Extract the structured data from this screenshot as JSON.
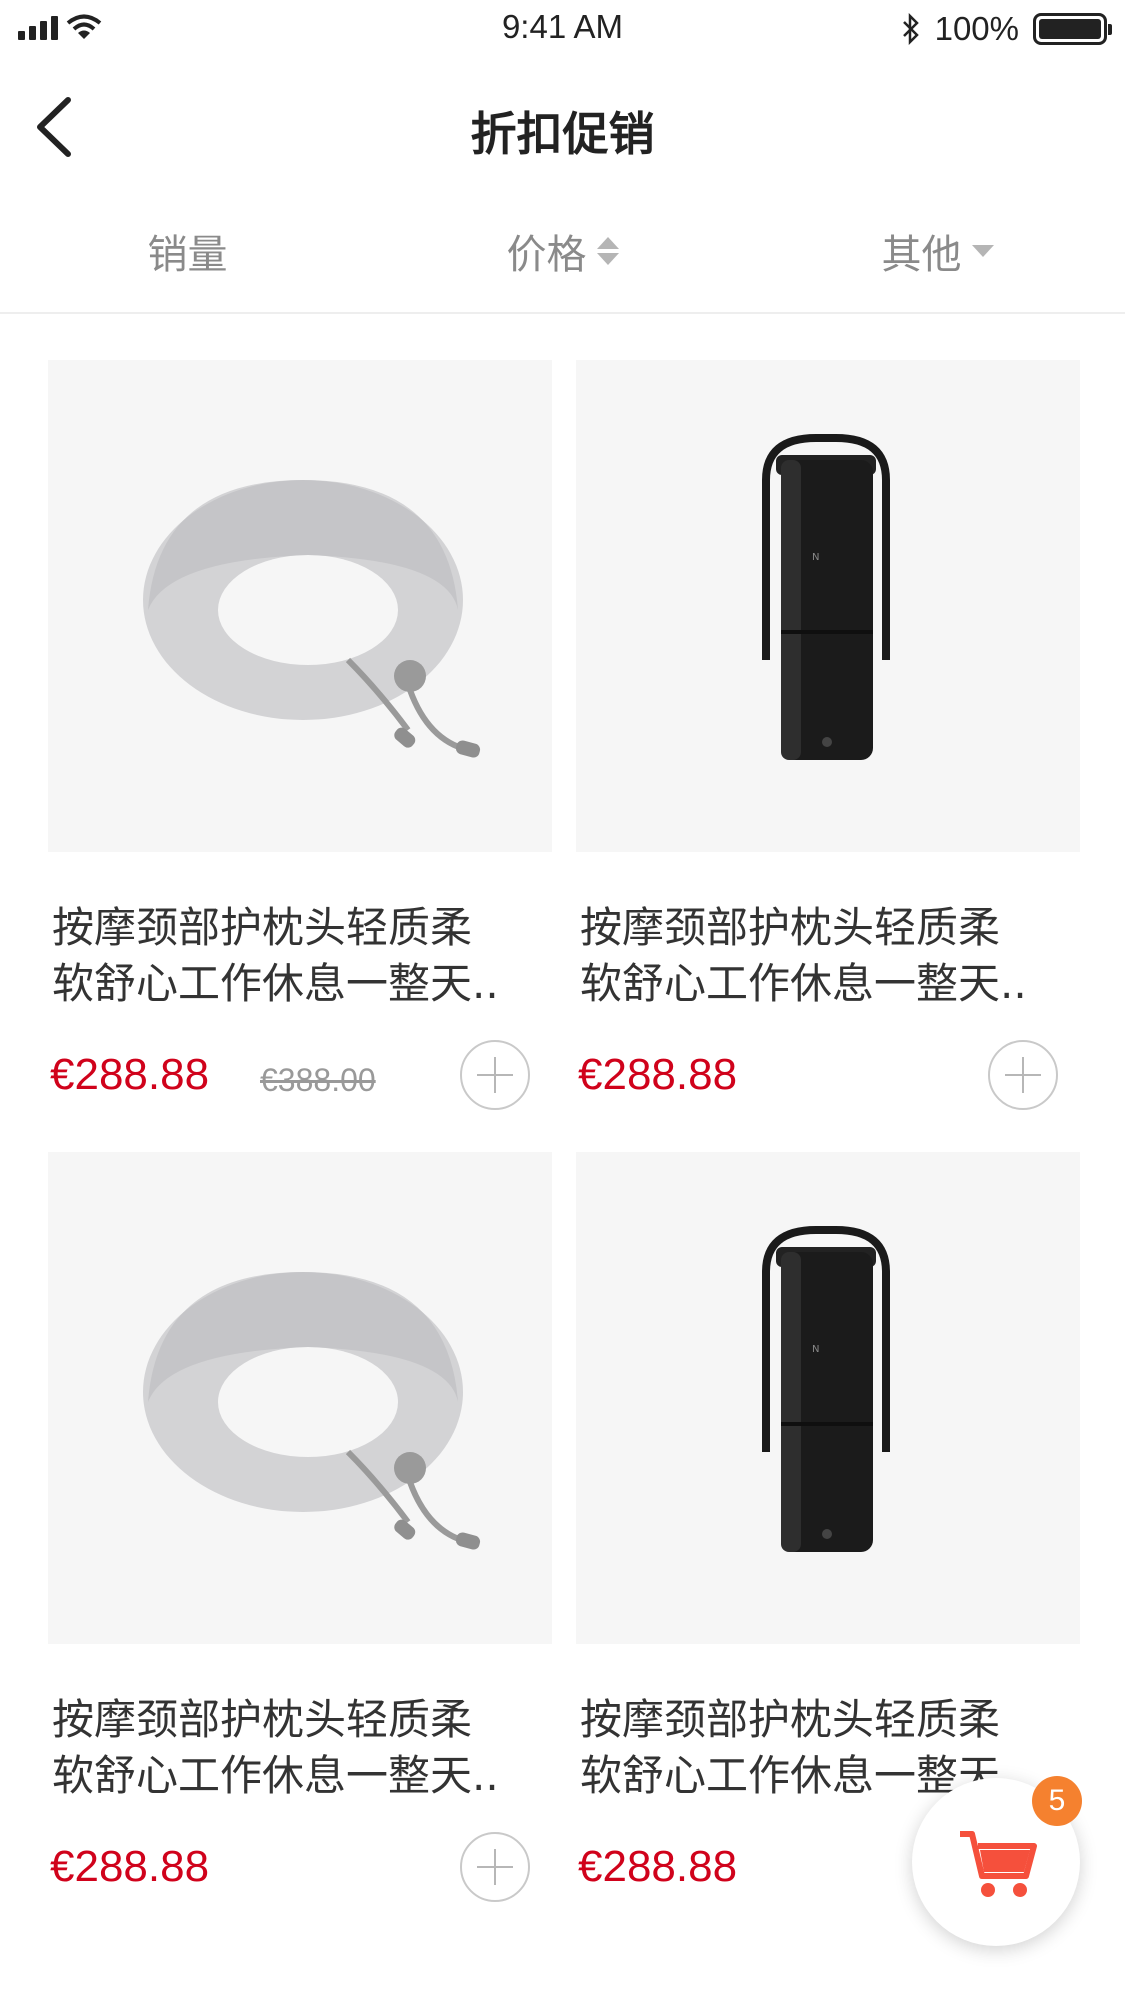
{
  "status_bar": {
    "time": "9:41 AM",
    "battery_text": "100%",
    "battery_level": 1.0,
    "icons": [
      "signal-icon",
      "wifi-icon",
      "bluetooth-icon",
      "battery-icon"
    ]
  },
  "nav": {
    "title": "折扣促销",
    "back_icon": "back-arrow-icon"
  },
  "filters": {
    "sales": "销量",
    "price": "价格",
    "other": "其他"
  },
  "products": [
    {
      "image": "neck-pillow",
      "title_line1": "按摩颈部护枕头轻质柔",
      "title_line2": "软舒心工作休息一整天..",
      "price": "€288.88",
      "old_price": "€388.00"
    },
    {
      "image": "portable-device",
      "title_line1": "按摩颈部护枕头轻质柔",
      "title_line2": "软舒心工作休息一整天..",
      "price": "€288.88",
      "old_price": ""
    },
    {
      "image": "neck-pillow",
      "title_line1": "按摩颈部护枕头轻质柔",
      "title_line2": "软舒心工作休息一整天..",
      "price": "€288.88",
      "old_price": ""
    },
    {
      "image": "portable-device",
      "title_line1": "按摩颈部护枕头轻质柔",
      "title_line2": "软舒心工作休息一整天..",
      "price": "€288.88",
      "old_price": ""
    }
  ],
  "cart": {
    "badge_count": "5",
    "icon": "cart-icon"
  },
  "colors": {
    "price": "#d0021b",
    "badge": "#f5812f",
    "cart": "#f5503c"
  }
}
